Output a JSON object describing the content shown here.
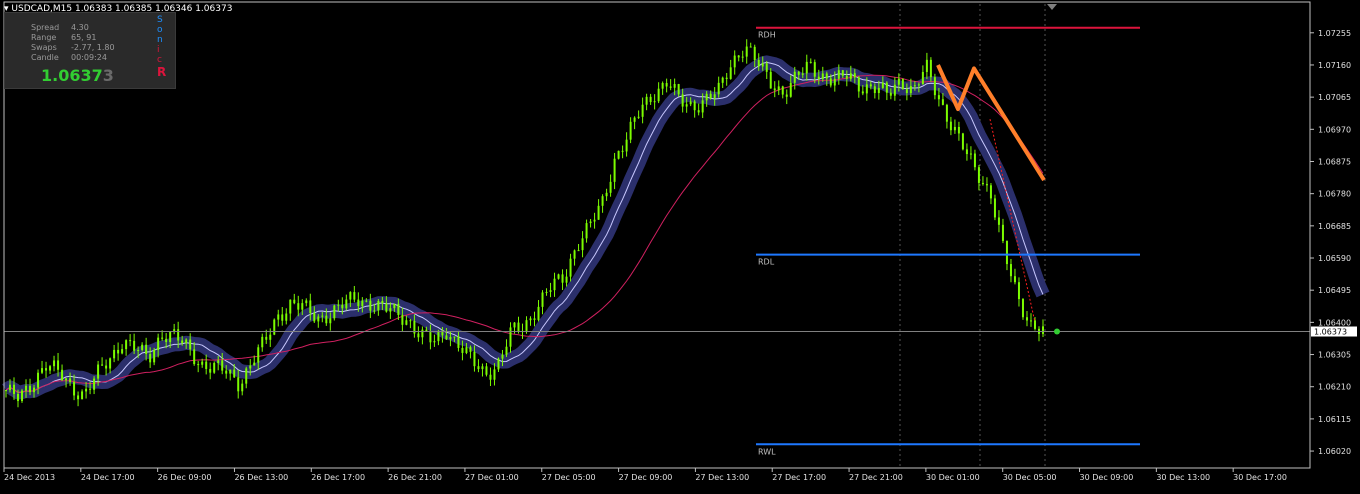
{
  "header": {
    "symbol_tf": "USDCAD,M15",
    "ohlc": "1.06383 1.06385 1.06346 1.06373",
    "overlay_text": "USDCAD  M15"
  },
  "info_panel": {
    "spread_label": "Spread",
    "spread_value": "4.30",
    "range_label": "Range",
    "range_value": "65, 91",
    "swaps_label": "Swaps",
    "swaps_value": "-2.77, 1.80",
    "candle_label": "Candle",
    "candle_value": "00:09:24",
    "price_main": "1.0637",
    "price_last": "3",
    "sonic_letters": [
      "S",
      "o",
      "n",
      "i",
      "c",
      "R"
    ],
    "sonic_colors": [
      "#1e90ff",
      "#1e90ff",
      "#1e90ff",
      "#dc143c",
      "#dc143c",
      "#dc143c"
    ]
  },
  "levels": [
    {
      "label": "RDH",
      "price": 1.0727,
      "color": "#dc143c"
    },
    {
      "label": "RDL",
      "price": 1.066,
      "color": "#1e78ff"
    },
    {
      "label": "RWL",
      "price": 1.0604,
      "color": "#1e78ff"
    }
  ],
  "current_price": {
    "label": "1.06373",
    "price": 1.06373
  },
  "chart_data": {
    "type": "candlestick",
    "symbol": "USDCAD",
    "timeframe": "M15",
    "ylim": [
      1.0597,
      1.0734
    ],
    "y_ticks": [
      "1.07255",
      "1.07160",
      "1.07065",
      "1.06970",
      "1.06875",
      "1.06780",
      "1.06685",
      "1.06590",
      "1.06495",
      "1.06400",
      "1.06305",
      "1.06210",
      "1.06115",
      "1.06020"
    ],
    "x_ticks": [
      "24 Dec 2013",
      "24 Dec 17:00",
      "26 Dec 09:00",
      "26 Dec 13:00",
      "26 Dec 17:00",
      "26 Dec 21:00",
      "27 Dec 01:00",
      "27 Dec 05:00",
      "27 Dec 09:00",
      "27 Dec 13:00",
      "27 Dec 17:00",
      "27 Dec 21:00",
      "30 Dec 01:00",
      "30 Dec 05:00",
      "30 Dec 09:00",
      "30 Dec 13:00",
      "30 Dec 17:00"
    ],
    "close_path": [
      1.062,
      1.0617,
      1.0622,
      1.0628,
      1.0625,
      1.0621,
      1.0619,
      1.0624,
      1.0629,
      1.0635,
      1.0632,
      1.0629,
      1.0637,
      1.0636,
      1.0632,
      1.0628,
      1.0627,
      1.0625,
      1.0622,
      1.0629,
      1.0634,
      1.0642,
      1.0646,
      1.0644,
      1.0641,
      1.0643,
      1.0645,
      1.0647,
      1.0646,
      1.0644,
      1.0643,
      1.0641,
      1.0636,
      1.0634,
      1.0638,
      1.0633,
      1.0628,
      1.0625,
      1.0628,
      1.0637,
      1.0639,
      1.0645,
      1.065,
      1.0653,
      1.0663,
      1.0668,
      1.0675,
      1.0689,
      1.0695,
      1.0703,
      1.0708,
      1.0711,
      1.0705,
      1.0704,
      1.0706,
      1.0708,
      1.0717,
      1.0722,
      1.0716,
      1.0711,
      1.0708,
      1.0712,
      1.0716,
      1.0713,
      1.0711,
      1.0713,
      1.071,
      1.0709,
      1.0707,
      1.0712,
      1.0708,
      1.0715,
      1.0706,
      1.0698,
      1.069,
      1.0684,
      1.0678,
      1.066,
      1.0648,
      1.064,
      1.0637
    ],
    "annotations": [
      {
        "type": "trend_zigzag",
        "color": "#ff7f2a",
        "points": [
          [
            0,
            1.0716
          ],
          [
            1,
            1.0703
          ],
          [
            2,
            1.0715
          ],
          [
            3,
            1.0682
          ]
        ]
      },
      {
        "type": "projection_dashed",
        "color": "#ff2020",
        "from": 1.07,
        "to": 1.064
      }
    ]
  }
}
